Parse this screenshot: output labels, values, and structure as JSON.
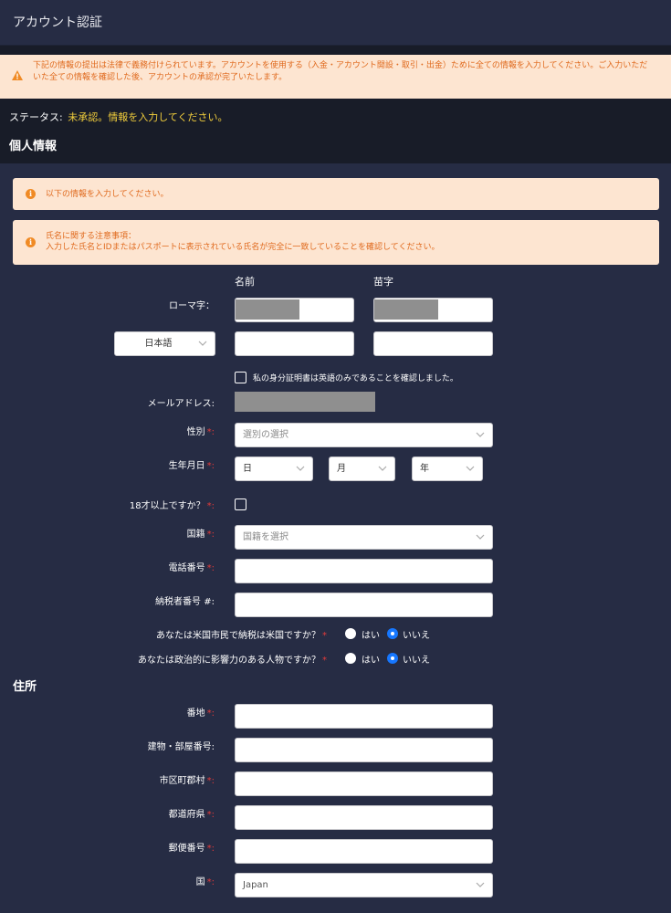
{
  "header": {
    "title": "アカウント認証"
  },
  "alert": {
    "line1": "下記の情報の提出は法律で義務付けられています。アカウントを使用する（入金・アカウント開設・取引・出金）ために全ての情報を入力してください。ご入力いただ",
    "line2": "いた全ての情報を確認した後、アカウントの承認が完了いたします。"
  },
  "status": {
    "label": "ステータス:",
    "value": "未承認。情報を入力してください。"
  },
  "personal": {
    "title": "個人情報",
    "notice1": "以下の情報を入力してください。",
    "notice2_line1": "氏名に関する注意事項：",
    "notice2_line2": "入力した氏名とIDまたはパスポートに表示されている氏名が完全に一致していることを確認してください。",
    "col_first": "名前",
    "col_last": "苗字",
    "romaji_label": "ローマ字：",
    "lang_select": "日本語",
    "english_only_check": "私の身分証明書は英語のみであることを確認しました。",
    "email_label": "メールアドレス:",
    "gender_label": "性別",
    "gender_placeholder": "選別の選択",
    "dob_label": "生年月日",
    "dob_day": "日",
    "dob_month": "月",
    "dob_year": "年",
    "adult_label": "18才以上ですか？",
    "nationality_label": "国籍",
    "nationality_placeholder": "国籍を選択",
    "phone_label": "電話番号",
    "tax_label": "納税者番号 #:",
    "us_citizen_question": "あなたは米国市民で納税は米国ですか？",
    "pep_question": "あなたは政治的に影響力のある人物ですか？",
    "yes": "はい",
    "no": "いいえ"
  },
  "address": {
    "title": "住所",
    "street_label": "番地",
    "building_label": "建物・部屋番号:",
    "city_label": "市区町郡村",
    "prefecture_label": "都道府県",
    "postal_label": "郵便番号",
    "country_label": "国",
    "country_value": "Japan"
  },
  "colors": {
    "background": "#262c44",
    "alert_bg": "#fde5d1",
    "alert_text": "#e06a1e",
    "status_value": "#f3cf3c",
    "required": "#e23b3b",
    "radio_selected": "#1677ff"
  }
}
